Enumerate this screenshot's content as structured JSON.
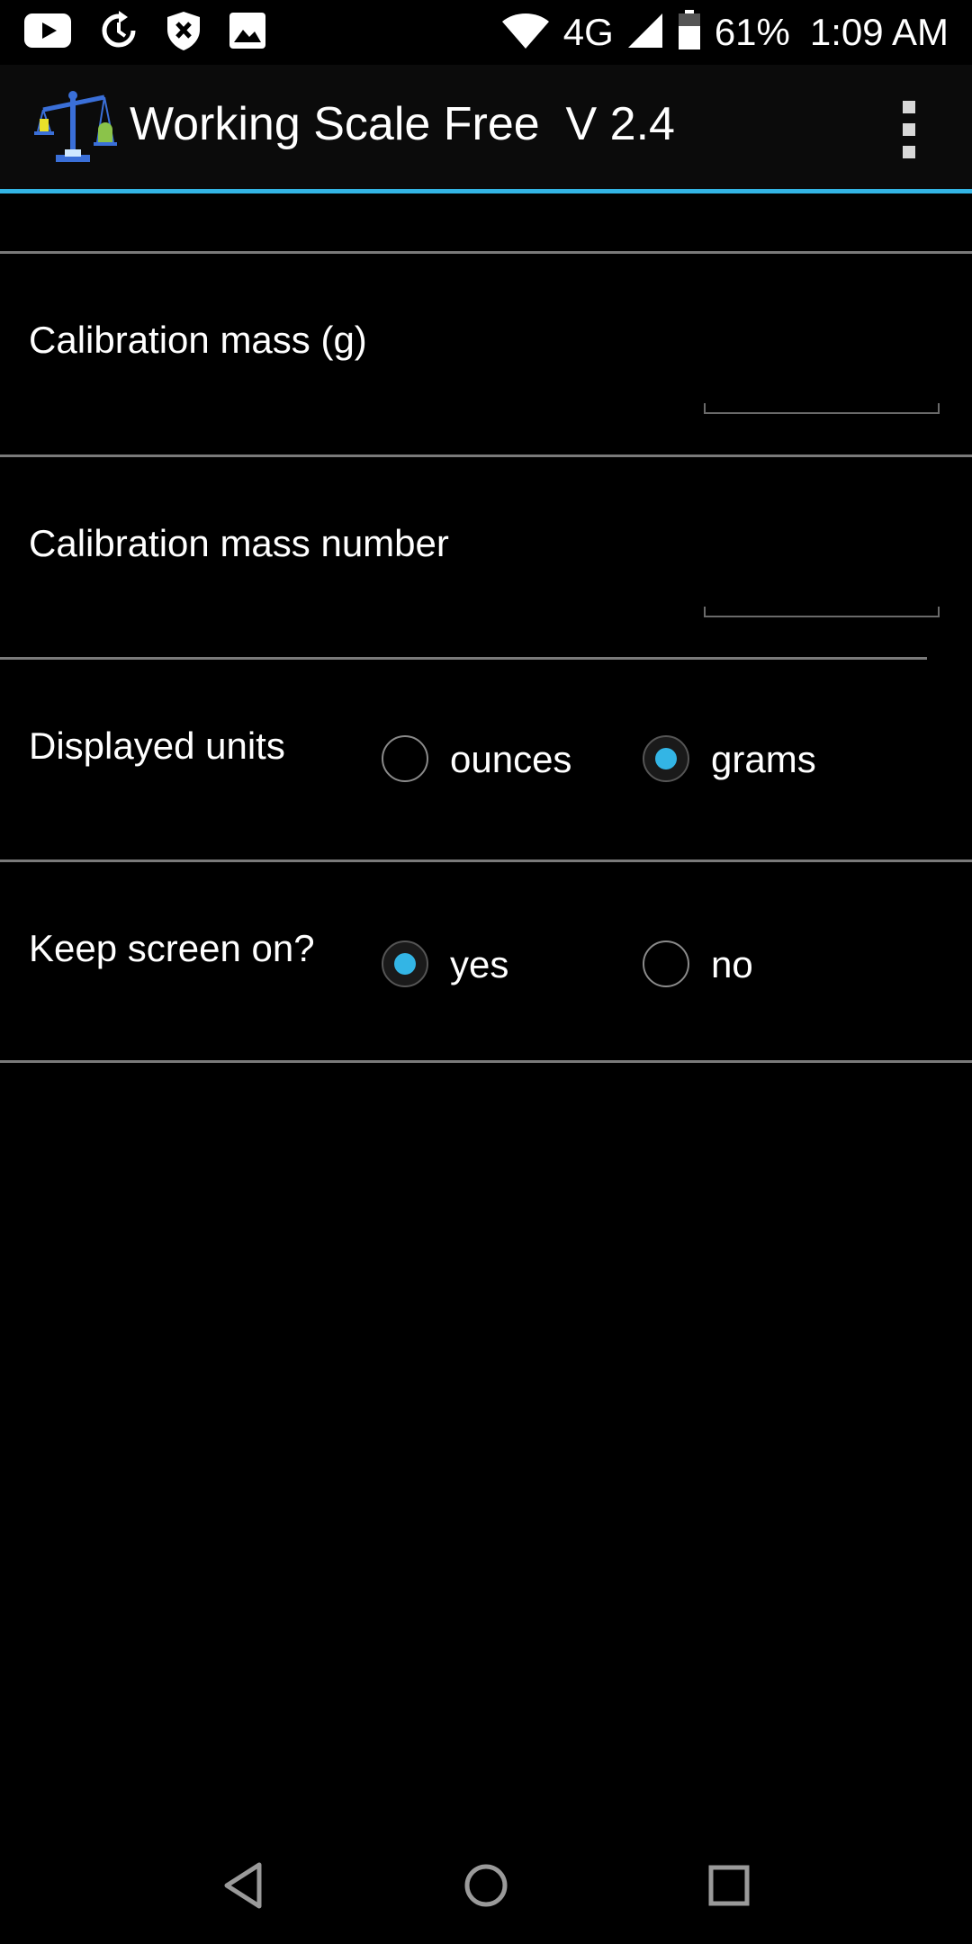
{
  "status_bar": {
    "network": "4G",
    "battery": "61%",
    "time": "1:09 AM",
    "left_icons": [
      "youtube-icon",
      "sync-icon",
      "shield-icon",
      "image-icon"
    ],
    "right_icons": [
      "wifi-icon",
      "signal-icon",
      "battery-icon"
    ]
  },
  "app_bar": {
    "title": "Working Scale Free  V 2.4",
    "icon": "scale-app-icon",
    "menu_icon": "overflow-menu-icon",
    "accent_color": "#33b5e5"
  },
  "settings": {
    "calibration_mass": {
      "label": "Calibration mass (g)",
      "value": ""
    },
    "calibration_mass_number": {
      "label": "Calibration mass number",
      "value": ""
    },
    "displayed_units": {
      "label": "Displayed units",
      "options": [
        {
          "label": "ounces",
          "checked": false
        },
        {
          "label": "grams",
          "checked": true
        }
      ]
    },
    "keep_screen_on": {
      "label": "Keep screen on?",
      "options": [
        {
          "label": "yes",
          "checked": true
        },
        {
          "label": "no",
          "checked": false
        }
      ]
    }
  },
  "nav_bar": {
    "icons": [
      "back-icon",
      "home-icon",
      "recents-icon"
    ]
  }
}
